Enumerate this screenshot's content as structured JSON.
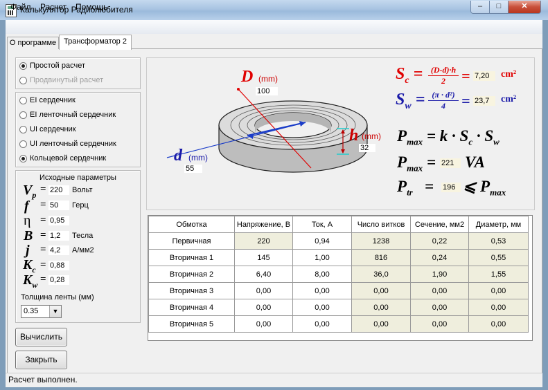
{
  "window": {
    "title": "Калькулятор Радиолюбителя",
    "min": "–",
    "max": "□",
    "close": "✕"
  },
  "menu": [
    "Файл",
    "Расчет",
    "Помощь"
  ],
  "tabs": [
    "О программе",
    "Трансформатор 2"
  ],
  "mode": {
    "simple": "Простой расчет",
    "advanced": "Продвинутый расчет",
    "selected": "simple"
  },
  "cores": [
    "EI сердечник",
    "EI ленточный сердечник",
    "UI сердечник",
    "UI ленточный сердечник",
    "Кольцевой сердечник"
  ],
  "selected_core": 4,
  "params": {
    "title": "Исходные параметры",
    "rows": [
      {
        "sym": "V",
        "sub": "p",
        "value": "220",
        "unit": "Вольт"
      },
      {
        "sym": "f",
        "sub": "",
        "value": "50",
        "unit": "Герц"
      },
      {
        "sym": "η",
        "sub": "",
        "value": "0,95",
        "unit": ""
      },
      {
        "sym": "B",
        "sub": "",
        "value": "1,2",
        "unit": "Тесла"
      },
      {
        "sym": "j",
        "sub": "",
        "value": "4,2",
        "unit": "А/мм2"
      },
      {
        "sym": "K",
        "sub": "c",
        "value": "0,88",
        "unit": ""
      },
      {
        "sym": "K",
        "sub": "w",
        "value": "0,28",
        "unit": ""
      }
    ],
    "tape_label": "Толщина ленты (мм)",
    "tape_value": "0.35"
  },
  "buttons": {
    "calc": "Вычислить",
    "close": "Закрыть"
  },
  "diagram": {
    "D": "D",
    "D_unit": "(mm)",
    "D_val": "100",
    "d": "d",
    "d_unit": "(mm)",
    "d_val": "55",
    "h": "h",
    "h_unit": "(mm)",
    "h_val": "32",
    "sc_val": "7,20",
    "sw_val": "23,7",
    "cm2": "cm²",
    "sc_num": "(D-d)·h",
    "sc_den": "2",
    "sw_num": "(π · d²)",
    "sw_den": "4",
    "pmax_formula": "= k · S",
    "va": "VA",
    "pmax_val": "221",
    "ptr_val": "196"
  },
  "table": {
    "headers": [
      "Обмотка",
      "Напряжение, В",
      "Ток, А",
      "Число витков",
      "Сечение, мм2",
      "Диаметр, мм"
    ],
    "rows": [
      [
        "Первичная",
        "220",
        "0,94",
        "1238",
        "0,22",
        "0,53"
      ],
      [
        "Вторичная 1",
        "145",
        "1,00",
        "816",
        "0,24",
        "0,55"
      ],
      [
        "Вторичная 2",
        "6,40",
        "8,00",
        "36,0",
        "1,90",
        "1,55"
      ],
      [
        "Вторичная 3",
        "0,00",
        "0,00",
        "0,00",
        "0,00",
        "0,00"
      ],
      [
        "Вторичная 4",
        "0,00",
        "0,00",
        "0,00",
        "0,00",
        "0,00"
      ],
      [
        "Вторичная 5",
        "0,00",
        "0,00",
        "0,00",
        "0,00",
        "0,00"
      ]
    ]
  },
  "status": "Расчет выполнен.",
  "colors": {
    "red": "#e00000",
    "blue": "#0000c8",
    "cell_yellow": "#efeedd"
  }
}
